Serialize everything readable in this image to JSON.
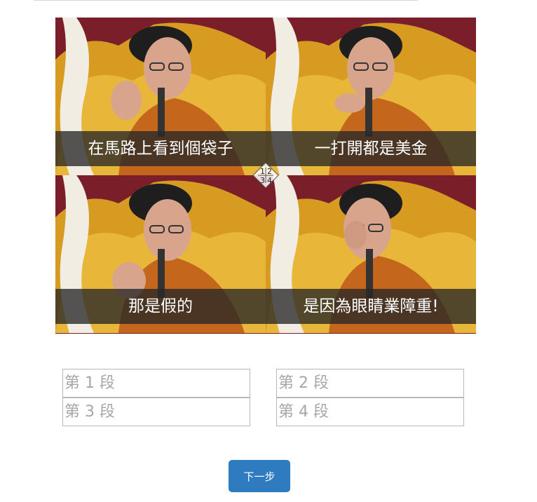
{
  "panels": [
    {
      "caption": "在馬路上看到個袋子"
    },
    {
      "caption": "一打開都是美金"
    },
    {
      "caption": "那是假的"
    },
    {
      "caption": "是因為眼睛業障重!"
    }
  ],
  "center_marker": {
    "n1": "1",
    "n2": "2",
    "n3": "3",
    "n4": "4"
  },
  "segments": {
    "seg1_placeholder": "第 1 段",
    "seg2_placeholder": "第 2 段",
    "seg3_placeholder": "第 3 段",
    "seg4_placeholder": "第 4 段"
  },
  "next_button": {
    "label": "下一步"
  },
  "colors": {
    "button": "#2f7bbf",
    "caption_bg": "#282828",
    "robe": "#e0a21c",
    "backdrop": "#7a1f2a"
  }
}
